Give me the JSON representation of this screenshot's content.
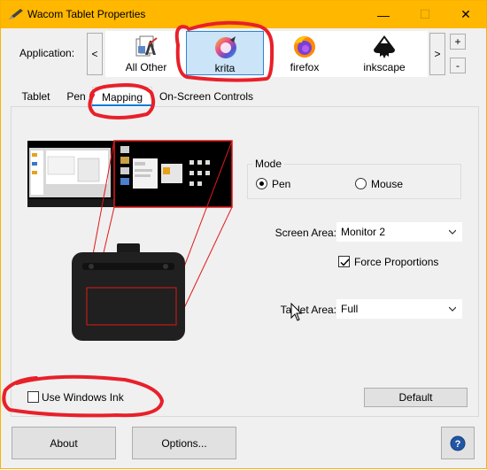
{
  "window": {
    "title": "Wacom Tablet Properties",
    "minimize_glyph": "—",
    "maximize_glyph": "☐",
    "close_glyph": "✕"
  },
  "application": {
    "label": "Application:",
    "scroll_left": "<",
    "scroll_right": ">",
    "add": "+",
    "remove": "-",
    "apps": [
      {
        "label": "All Other",
        "icon": "all-other-icon"
      },
      {
        "label": "krita",
        "icon": "krita-icon",
        "selected": true
      },
      {
        "label": "firefox",
        "icon": "firefox-icon"
      },
      {
        "label": "inkscape",
        "icon": "inkscape-icon"
      }
    ]
  },
  "tabs": [
    "Tablet",
    "Pen",
    "Mapping",
    "On-Screen Controls"
  ],
  "active_tab": "Mapping",
  "mapping": {
    "mode": {
      "title": "Mode",
      "options": [
        "Pen",
        "Mouse"
      ],
      "selected": "Pen"
    },
    "screen_area": {
      "label": "Screen Area:",
      "value": "Monitor 2"
    },
    "force_proportions": {
      "label": "Force Proportions",
      "checked": true
    },
    "tablet_area": {
      "label": "Tablet Area:",
      "value": "Full"
    },
    "use_windows_ink": {
      "label": "Use Windows Ink",
      "checked": false
    },
    "default_button": "Default"
  },
  "footer": {
    "about": "About",
    "options": "Options...",
    "help_glyph": "?"
  },
  "colors": {
    "titlebar": "#ffb700",
    "accent": "#0078d7",
    "annotation": "#e8202a",
    "help": "#2255a4"
  }
}
